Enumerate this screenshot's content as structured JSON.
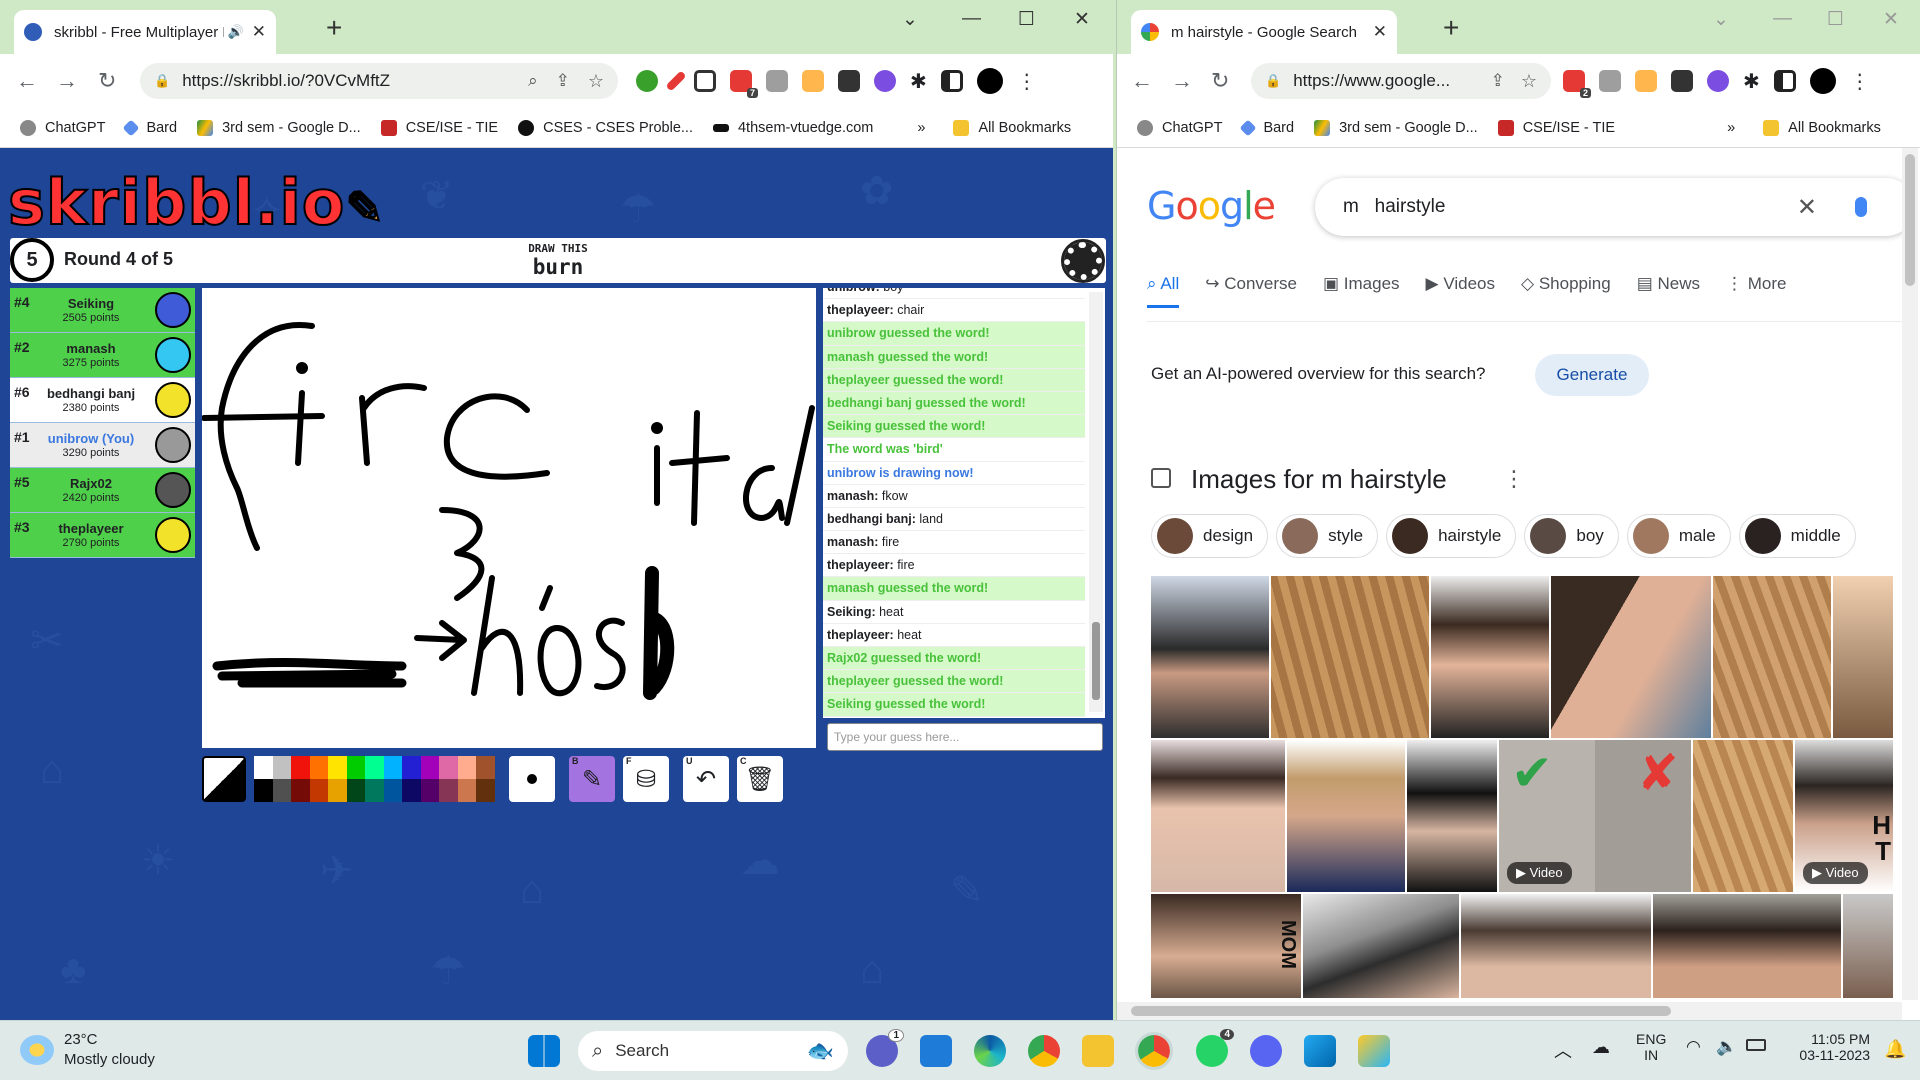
{
  "left_window": {
    "tab_title": "skribbl - Free Multiplayer Dr",
    "url": "https://skribbl.io/?0VCvMftZ",
    "ext_badge": "7",
    "bookmarks": [
      "ChatGPT",
      "Bard",
      "3rd sem - Google D...",
      "CSE/ISE - TIE",
      "CSES - CSES Proble...",
      "4thsem-vtuedge.com"
    ],
    "bookmarks_more": "»",
    "all_bookmarks": "All Bookmarks"
  },
  "right_window": {
    "tab_title": "m hairstyle - Google Search",
    "url": "https://www.google...",
    "ext_badge": "2",
    "bookmarks": [
      "ChatGPT",
      "Bard",
      "3rd sem - Google D...",
      "CSE/ISE - TIE"
    ],
    "bookmarks_more": "»",
    "all_bookmarks": "All Bookmarks"
  },
  "game": {
    "logo": "skribbl.io",
    "timer": "5",
    "round": "Round 4 of 5",
    "draw_this": "DRAW THIS",
    "word": "burn",
    "players": [
      {
        "rank": "#4",
        "name": "Seiking",
        "points": "2505 points",
        "bg": "#4fd04a",
        "avatar": "#3f5bd8"
      },
      {
        "rank": "#2",
        "name": "manash",
        "points": "3275 points",
        "bg": "#4fd04a",
        "avatar": "#33c7f2"
      },
      {
        "rank": "#6",
        "name": "bedhangi banj",
        "points": "2380 points",
        "bg": "#ffffff",
        "avatar": "#f2e22a"
      },
      {
        "rank": "#1",
        "name": "unibrow (You)",
        "points": "3290 points",
        "bg": "#ececec",
        "avatar": "#999999"
      },
      {
        "rank": "#5",
        "name": "Rajx02",
        "points": "2420 points",
        "bg": "#4fd04a",
        "avatar": "#555555"
      },
      {
        "rank": "#3",
        "name": "theplayeer",
        "points": "2790 points",
        "bg": "#4fd04a",
        "avatar": "#f2e22a"
      }
    ],
    "chat": [
      {
        "who": "unibrow:",
        "text": "boy",
        "type": "n"
      },
      {
        "who": "theplayeer:",
        "text": "chair",
        "type": "n"
      },
      {
        "who": "",
        "text": "unibrow guessed the word!",
        "type": "g"
      },
      {
        "who": "",
        "text": "manash guessed the word!",
        "type": "g"
      },
      {
        "who": "",
        "text": "theplayeer guessed the word!",
        "type": "g"
      },
      {
        "who": "",
        "text": "bedhangi banj guessed the word!",
        "type": "g"
      },
      {
        "who": "",
        "text": "Seiking guessed the word!",
        "type": "g"
      },
      {
        "who": "",
        "text": "The word was 'bird'",
        "type": "w"
      },
      {
        "who": "",
        "text": "unibrow is drawing now!",
        "type": "b"
      },
      {
        "who": "manash:",
        "text": "fkow",
        "type": "n"
      },
      {
        "who": "bedhangi banj:",
        "text": "land",
        "type": "n"
      },
      {
        "who": "manash:",
        "text": "fire",
        "type": "n"
      },
      {
        "who": "theplayeer:",
        "text": "fire",
        "type": "n"
      },
      {
        "who": "",
        "text": "manash guessed the word!",
        "type": "g"
      },
      {
        "who": "Seiking:",
        "text": "heat",
        "type": "n"
      },
      {
        "who": "theplayeer:",
        "text": "heat",
        "type": "n"
      },
      {
        "who": "",
        "text": "Rajx02 guessed the word!",
        "type": "g"
      },
      {
        "who": "",
        "text": "theplayeer guessed the word!",
        "type": "g"
      },
      {
        "who": "",
        "text": "Seiking guessed the word!",
        "type": "g"
      }
    ],
    "guess_placeholder": "Type your guess here...",
    "palette": [
      "#ffffff",
      "#c1c1c1",
      "#ef130b",
      "#ff7100",
      "#ffe400",
      "#00cc00",
      "#00ff91",
      "#00b2ff",
      "#231fd3",
      "#a300ba",
      "#df69a7",
      "#ffac8e",
      "#a0522d",
      "#000000",
      "#505050",
      "#740b07",
      "#c23800",
      "#e8a200",
      "#004619",
      "#00785d",
      "#00569e",
      "#0e0865",
      "#550069",
      "#873554",
      "#cc774d",
      "#63300d"
    ],
    "tool_keys": {
      "brush": "B",
      "fill": "F",
      "undo": "U",
      "clear": "C"
    }
  },
  "google": {
    "logo": "Google",
    "query": "m   hairstyle",
    "tabs": [
      "All",
      "Converse",
      "Images",
      "Videos",
      "Shopping",
      "News",
      "More"
    ],
    "ai_prompt": "Get an AI-powered overview for this search?",
    "generate": "Generate",
    "images_heading": "Images for m hairstyle",
    "chips": [
      "design",
      "style",
      "hairstyle",
      "boy",
      "male",
      "middle"
    ],
    "video_label": "Video",
    "side_letters": [
      "H",
      "T"
    ],
    "banner_letters": "MOM"
  },
  "taskbar": {
    "temp": "23°C",
    "weather": "Mostly cloudy",
    "search": "Search",
    "badge_chat": "1",
    "badge_whatsapp": "4",
    "lang1": "ENG",
    "lang2": "IN",
    "time": "11:05 PM",
    "date": "03-11-2023"
  }
}
